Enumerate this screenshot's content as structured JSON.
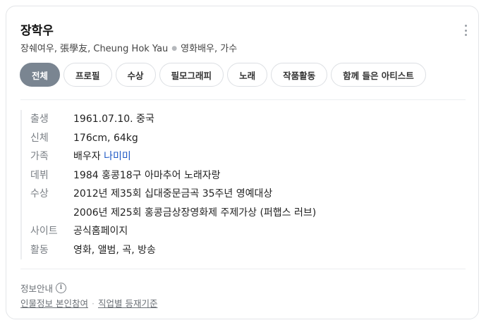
{
  "person": {
    "name": "장학우",
    "aliases": "장쉐여우, 張學友, Cheung Hok Yau",
    "roles": "영화배우, 가수"
  },
  "tabs": [
    {
      "label": "전체",
      "active": true
    },
    {
      "label": "프로필",
      "active": false
    },
    {
      "label": "수상",
      "active": false
    },
    {
      "label": "필모그래피",
      "active": false
    },
    {
      "label": "노래",
      "active": false
    },
    {
      "label": "작품활동",
      "active": false
    },
    {
      "label": "함께 들은 아티스트",
      "active": false
    }
  ],
  "info": {
    "birth_label": "출생",
    "birth_value": "1961.07.10. 중국",
    "body_label": "신체",
    "body_value": "176cm, 64kg",
    "family_label": "가족",
    "family_prefix": "배우자",
    "family_link": "나미미",
    "debut_label": "데뷔",
    "debut_value": "1984 홍콩18구 아마추어 노래자랑",
    "awards_label": "수상",
    "awards": [
      "2012년 제35회 십대중문금곡 35주년 영예대상",
      "2006년 제25회 홍콩금상장영화제 주제가상 (퍼햅스 러브)"
    ],
    "site_label": "사이트",
    "site_link": "공식홈페이지",
    "activity_label": "활동",
    "activity_link": "영화, 앨범, 곡, 방송"
  },
  "footer": {
    "title": "정보안내",
    "info_icon": "info-icon",
    "link1": "인물정보 본인참여",
    "link2": "직업별 등재기준"
  }
}
